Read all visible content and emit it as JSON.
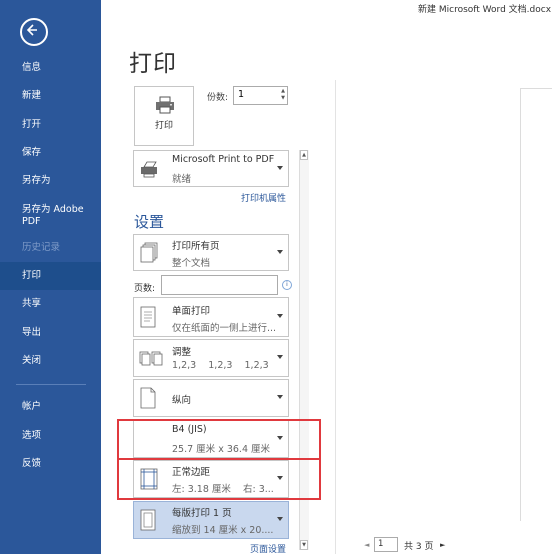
{
  "window": {
    "doc_title": "新建 Microsoft Word 文档.docx"
  },
  "sidebar": {
    "items": [
      {
        "label": "信息",
        "enabled": true
      },
      {
        "label": "新建",
        "enabled": true
      },
      {
        "label": "打开",
        "enabled": true
      },
      {
        "label": "保存",
        "enabled": true
      },
      {
        "label": "另存为",
        "enabled": true
      },
      {
        "label": "另存为 Adobe PDF",
        "enabled": true
      },
      {
        "label": "历史记录",
        "enabled": false
      },
      {
        "label": "打印",
        "enabled": true,
        "active": true
      },
      {
        "label": "共享",
        "enabled": true
      },
      {
        "label": "导出",
        "enabled": true
      },
      {
        "label": "关闭",
        "enabled": true
      },
      {
        "label": "帐户",
        "enabled": true
      },
      {
        "label": "选项",
        "enabled": true
      },
      {
        "label": "反馈",
        "enabled": true
      }
    ]
  },
  "main": {
    "title": "打印",
    "print_button_label": "打印",
    "copies_label": "份数:",
    "copies_value": "1",
    "printer": {
      "name": "Microsoft Print to PDF",
      "status": "就绪",
      "properties_link": "打印机属性"
    },
    "settings_heading": "设置",
    "range": {
      "line1": "打印所有页",
      "line2": "整个文档"
    },
    "pages_label": "页数:",
    "sides": {
      "line1": "单面打印",
      "line2": "仅在纸面的一侧上进行..."
    },
    "collate": {
      "line1": "调整",
      "line2": "1,2,3    1,2,3    1,2,3"
    },
    "orientation": {
      "line1": "纵向"
    },
    "paper": {
      "line1": "B4 (JIS)",
      "line2": "25.7 厘米 x 36.4 厘米"
    },
    "margins": {
      "line1": "正常边距",
      "line2": "左: 3.18 厘米    右: 3..."
    },
    "pages_per_sheet": {
      "line1": "每版打印 1 页",
      "line2": "缩放到 14 厘米 x 20...."
    },
    "page_setup_link": "页面设置"
  },
  "preview": {
    "page_number": "1",
    "total_pages": "共 3 页",
    "prev_icon": "◄",
    "next_icon": "►"
  },
  "colors": {
    "sidebar_bg": "#2b579a",
    "accent": "#2b579a",
    "highlight": "#e0393e"
  }
}
